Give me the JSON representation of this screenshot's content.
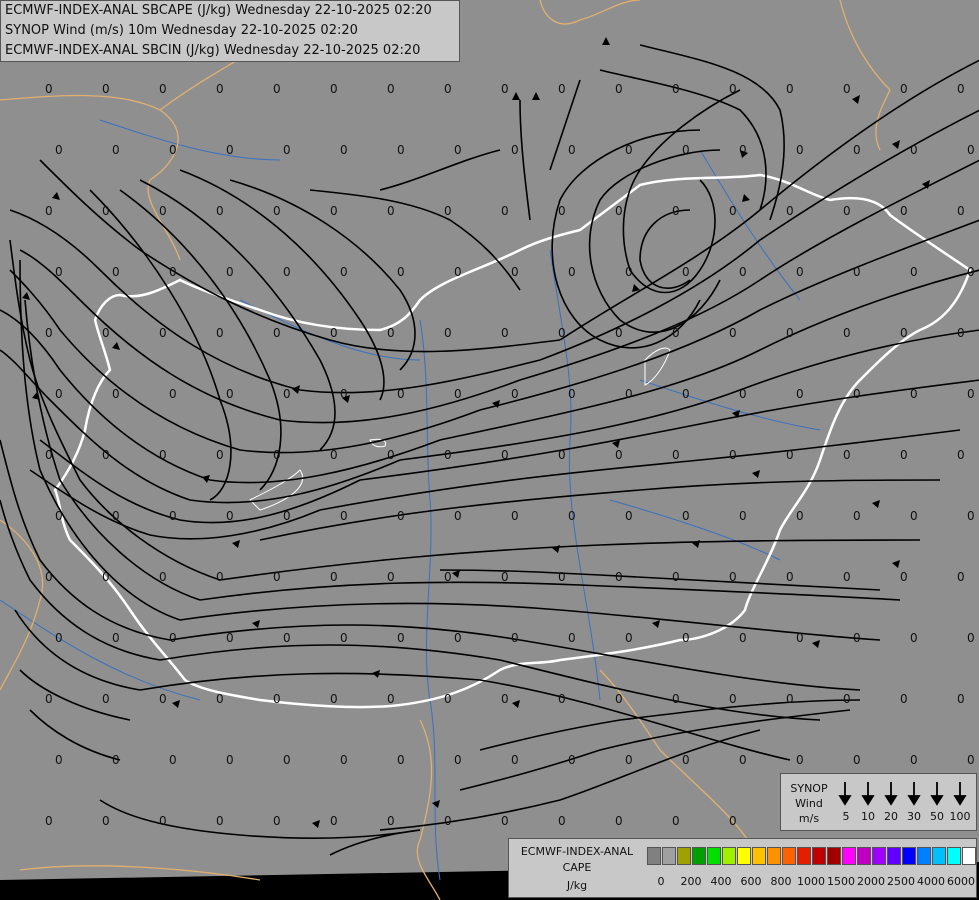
{
  "header": {
    "line1": "ECMWF-INDEX-ANAL SBCAPE (J/kg) Wednesday 22-10-2025 02:20",
    "line2": "SYNOP Wind (m/s) 10m Wednesday 22-10-2025 02:20",
    "line3": "ECMWF-INDEX-ANAL SBCIN (J/kg) Wednesday 22-10-2025 02:20"
  },
  "grid_value": "0",
  "colors": {
    "background": "#8f8f8f",
    "streamline": "#000000",
    "border_country": "#ffffff",
    "border_neighbour": "#e0b070",
    "river": "#3a70c0"
  },
  "wind_legend": {
    "title1": "SYNOP",
    "title2": "Wind",
    "unit": "m/s",
    "speeds": [
      "5",
      "10",
      "20",
      "30",
      "50",
      "100"
    ]
  },
  "cape_legend": {
    "title1": "ECMWF-INDEX-ANAL",
    "title2": "CAPE",
    "unit": "J/kg",
    "colors": [
      "#808080",
      "#a0a0a0",
      "#a0a000",
      "#00a000",
      "#00e000",
      "#a0f000",
      "#ffff00",
      "#ffc000",
      "#ff9000",
      "#ff6000",
      "#e02000",
      "#c00000",
      "#a00000",
      "#ff00ff",
      "#c000c0",
      "#a000ff",
      "#6000ff",
      "#0000ff",
      "#0080ff",
      "#00c0ff",
      "#00ffff",
      "#ffffff"
    ],
    "ticks": [
      "0",
      "200",
      "400",
      "600",
      "800",
      "1000",
      "1500",
      "2000",
      "2500",
      "4000",
      "6000"
    ]
  }
}
